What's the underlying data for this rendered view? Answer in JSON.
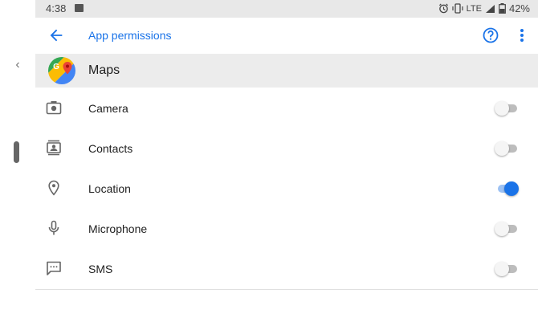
{
  "status_bar": {
    "time": "4:38",
    "network": "LTE",
    "battery": "42%"
  },
  "app_bar": {
    "title": "App permissions"
  },
  "app": {
    "name": "Maps"
  },
  "permissions": [
    {
      "label": "Camera",
      "enabled": false
    },
    {
      "label": "Contacts",
      "enabled": false
    },
    {
      "label": "Location",
      "enabled": true
    },
    {
      "label": "Microphone",
      "enabled": false
    },
    {
      "label": "SMS",
      "enabled": false
    }
  ],
  "colors": {
    "accent": "#1a73e8",
    "header_bg": "#ececec",
    "statusbar_bg": "#e8e8e8"
  }
}
